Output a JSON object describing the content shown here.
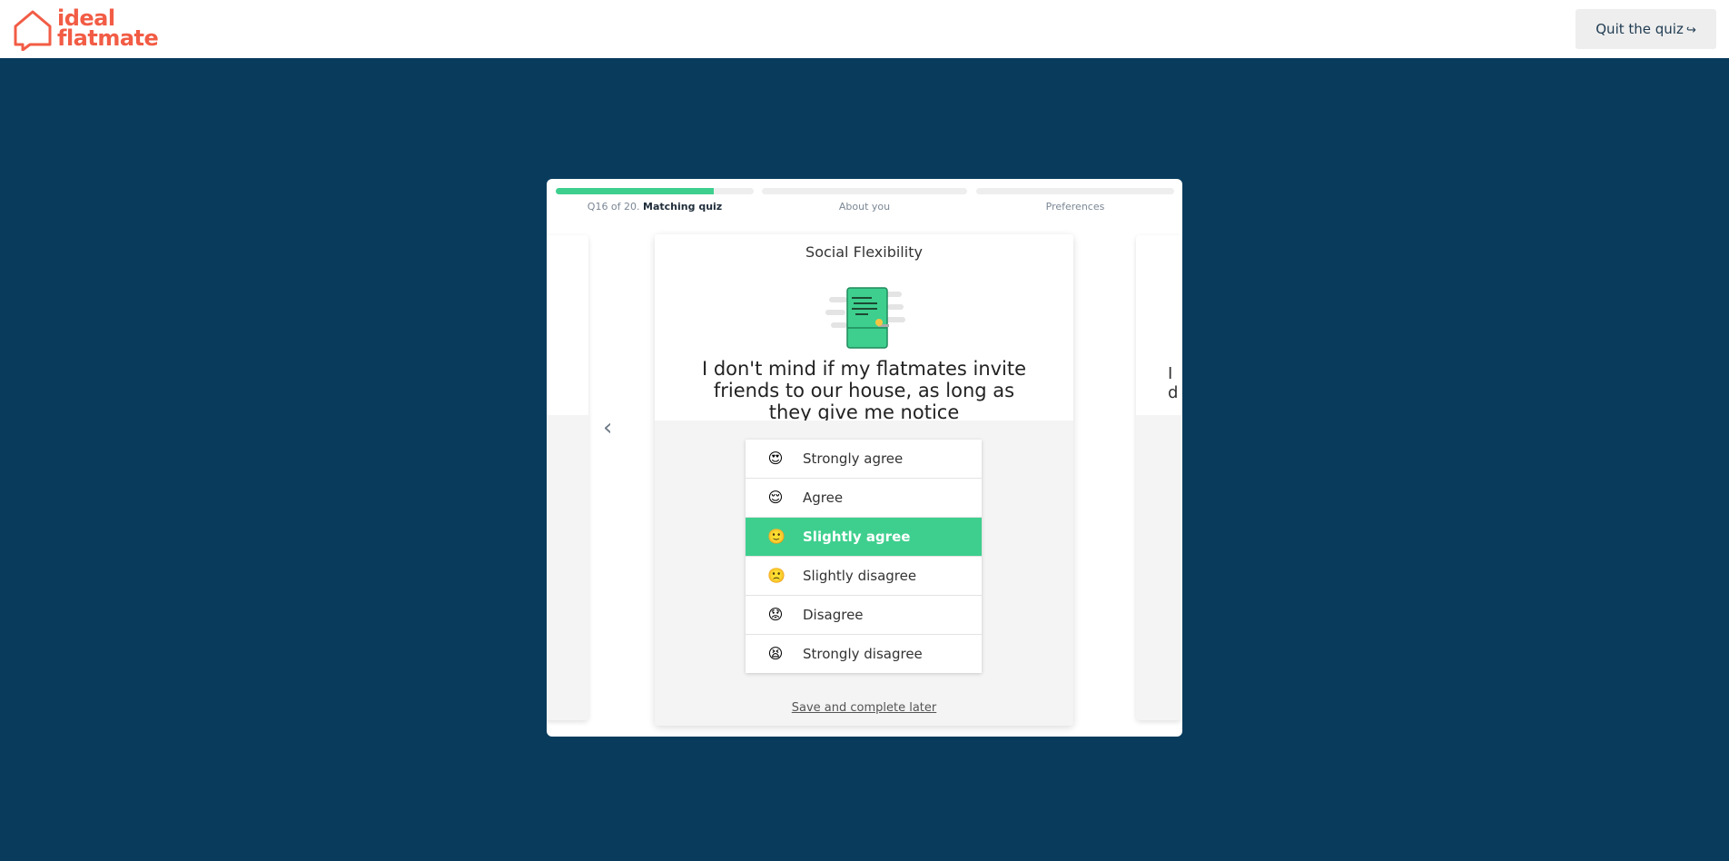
{
  "header": {
    "logo_line1": "ideal",
    "logo_line2": "flatmate",
    "quit_label": "Quit the quiz",
    "quit_icon": "exit-icon"
  },
  "progress": {
    "steps": [
      {
        "prefix": "Q16 of 20.",
        "label": "Matching quiz",
        "fill_fraction": 0.8
      },
      {
        "label": "About you",
        "fill_fraction": 0
      },
      {
        "label": "Preferences",
        "fill_fraction": 0
      }
    ]
  },
  "card": {
    "category": "Social Flexibility",
    "question": "I don't mind if my flatmates invite friends to our house, as long as they give me notice",
    "options": [
      {
        "label": "Strongly agree",
        "emoji": "😍"
      },
      {
        "label": "Agree",
        "emoji": "😌"
      },
      {
        "label": "Slightly agree",
        "emoji": "🙂"
      },
      {
        "label": "Slightly disagree",
        "emoji": "🙁"
      },
      {
        "label": "Disagree",
        "emoji": "😟"
      },
      {
        "label": "Strongly disagree",
        "emoji": "😫"
      }
    ],
    "selected_option": "Slightly agree",
    "save_later": "Save and complete later"
  },
  "next_card_peek": "I d",
  "colors": {
    "background": "#093b5c",
    "brand": "#f25c45",
    "accent": "#3ecf8e"
  }
}
